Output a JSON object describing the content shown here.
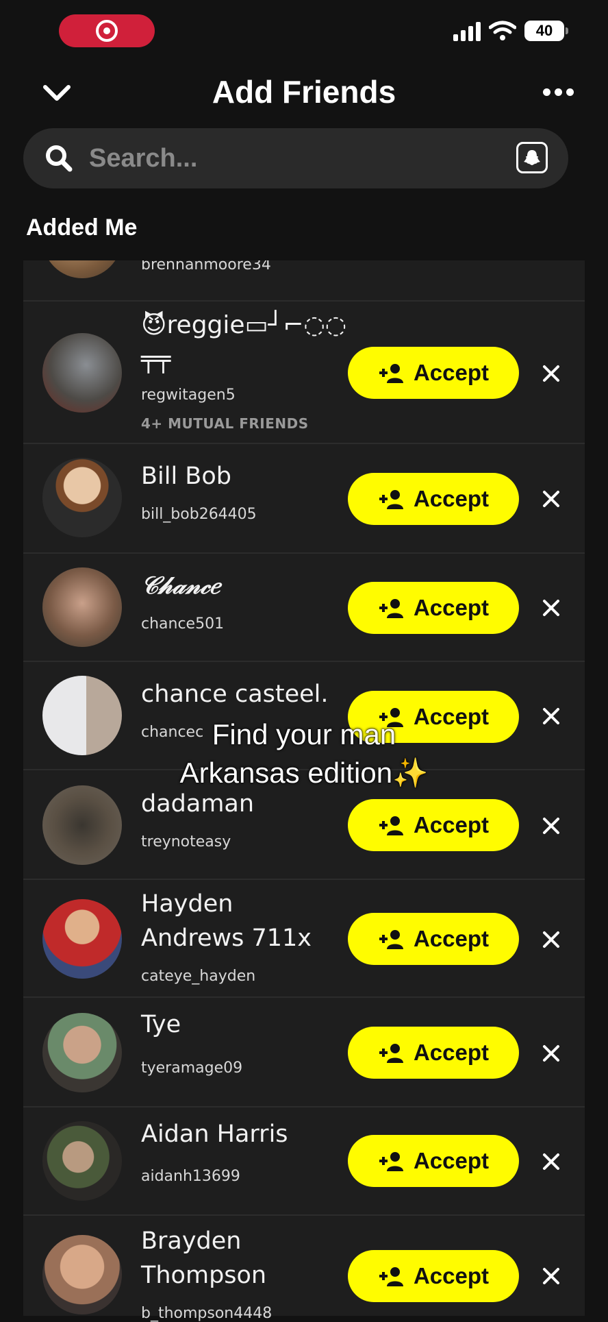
{
  "status_bar": {
    "battery": "40"
  },
  "header": {
    "title": "Add Friends",
    "search_placeholder": "Search...",
    "section_title": "Added Me"
  },
  "accept_label": "Accept",
  "overlay": {
    "line1": "Find your man",
    "line2": "Arkansas edition✨"
  },
  "rows": [
    {
      "name": "",
      "username": "brennanmoore34",
      "mutual": ""
    },
    {
      "name": "😈reggie▭┘⌐◌◌\n╤╤",
      "username": "regwitagen5",
      "mutual": "4+ MUTUAL FRIENDS"
    },
    {
      "name": "Bill Bob",
      "username": "bill_bob264405",
      "mutual": ""
    },
    {
      "name": "𝒞𝒽𝒶𝓃𝒸𝑒",
      "username": "chance501",
      "mutual": ""
    },
    {
      "name": "chance casteel.",
      "username": "chancec",
      "mutual": ""
    },
    {
      "name": "dadaman",
      "username": "treynoteasy",
      "mutual": ""
    },
    {
      "name": "Hayden\nAndrews 711x",
      "username": "cateye_hayden",
      "mutual": ""
    },
    {
      "name": "Tye",
      "username": "tyeramage09",
      "mutual": ""
    },
    {
      "name": "Aidan Harris",
      "username": "aidanh13699",
      "mutual": ""
    },
    {
      "name": "Brayden\nThompson",
      "username": "b_thompson4448",
      "mutual": ""
    }
  ],
  "colors": {
    "accept": "#fffc00",
    "background": "#121212",
    "card": "#1e1e1e",
    "record": "#d0203a"
  }
}
